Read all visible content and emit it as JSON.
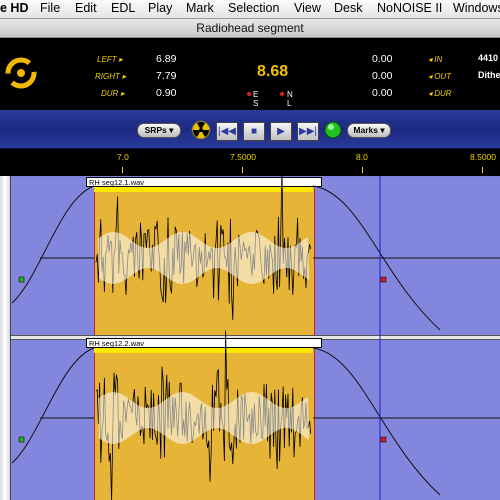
{
  "menubar": {
    "app_name": "e HD",
    "items": [
      "File",
      "Edit",
      "EDL",
      "Play",
      "Mark",
      "Selection",
      "View",
      "Desk",
      "NoNOISE II",
      "Windows"
    ]
  },
  "window": {
    "title": "Radiohead segment"
  },
  "counters": {
    "left_label": "LEFT",
    "left_value": "6.89",
    "right_label": "RIGHT",
    "right_value": "7.79",
    "dur_label": "DUR",
    "dur_value": "0.90",
    "main_value": "8.68",
    "indicators": [
      "E",
      "N",
      "S",
      "L"
    ],
    "in_value": "0.00",
    "out_value": "0.00",
    "dur2_value": "0.00",
    "in_label": "IN",
    "out_label": "OUT",
    "dur2_label": "DUR",
    "rate": "4410",
    "dither": "Dithe"
  },
  "toolbar": {
    "srps_label": "SRPs",
    "marks_label": "Marks",
    "rewind_glyph": "|◀◀",
    "stop_glyph": "■",
    "play_glyph": "▶",
    "ffwd_glyph": "▶▶|"
  },
  "ruler": {
    "ticks": [
      "7.0",
      "7.5000",
      "8.0",
      "8.5000"
    ]
  },
  "tracks": [
    {
      "region_name": "RH seg12.1.wav"
    },
    {
      "region_name": "RH seg12.2.wav"
    }
  ],
  "colors": {
    "track_bg": "#8286dc",
    "selection": "#e6b437",
    "counter_label": "#f0d000",
    "main_counter": "#f2c200"
  }
}
